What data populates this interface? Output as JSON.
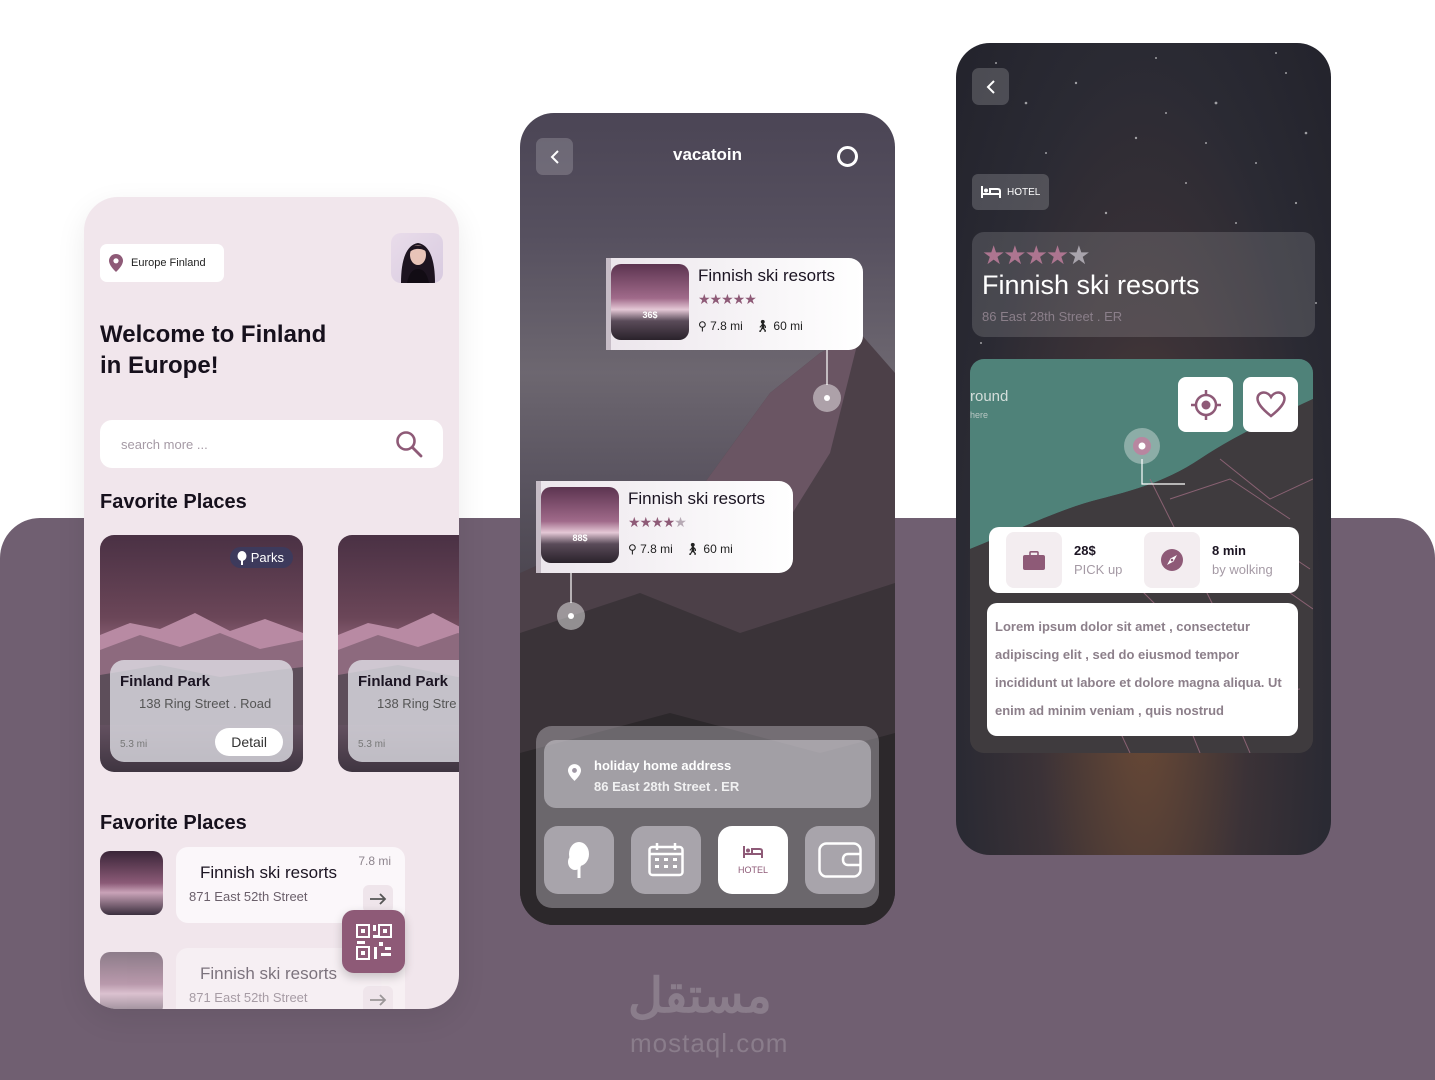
{
  "accent_color": "#8e5a77",
  "background_band_color": "#705f71",
  "screen1": {
    "location_chip": "Europe Finland",
    "welcome_line1": "Welcome to Finland",
    "welcome_line2": "in Europe!",
    "search_placeholder": "search more ...",
    "section1_title": "Favorite Places",
    "cards": [
      {
        "badge": "Parks",
        "title": "Finland Park",
        "subtitle": "138 Ring Street . Road",
        "distance": "5.3 mi",
        "button": "Detail"
      },
      {
        "title": "Finland Park",
        "subtitle": "138 Ring Stre",
        "distance": "5.3 mi"
      }
    ],
    "section2_title": "Favorite Places",
    "list": [
      {
        "title": "Finnish ski resorts",
        "subtitle": "871 East 52th Street",
        "distance": "7.8 mi"
      },
      {
        "title": "Finnish ski resorts",
        "subtitle": "871 East 52th Street"
      }
    ]
  },
  "screen2": {
    "title": "vacatoin",
    "resorts": [
      {
        "title": "Finnish ski resorts",
        "price": "36$",
        "rating": 5,
        "distance1": "7.8 mi",
        "distance2": "60 mi"
      },
      {
        "title": "Finnish ski resorts",
        "price": "88$",
        "rating": 4,
        "distance1": "7.8 mi",
        "distance2": "60 mi"
      }
    ],
    "address_label": "holiday home address",
    "address_value": "86 East 28th Street . ER",
    "tabs": [
      "park",
      "calendar",
      "HOTEL",
      "wallet"
    ],
    "active_tab_label": "HOTEL"
  },
  "screen3": {
    "badge": "HOTEL",
    "rating": 4,
    "title": "Finnish ski resorts",
    "address": "86 East 28th Street . ER",
    "map_text1": "round",
    "map_text2": "here",
    "price_value": "28$",
    "price_label": "PICK up",
    "time_value": "8 min",
    "time_label": "by wolking",
    "description": "Lorem ipsum dolor sit amet , consectetur adipiscing elit , sed do eiusmod tempor incididunt ut labore et dolore magna aliqua. Ut enim ad minim veniam , quis nostrud"
  },
  "watermark_ar": "مستقل",
  "watermark": "mostaql.com"
}
